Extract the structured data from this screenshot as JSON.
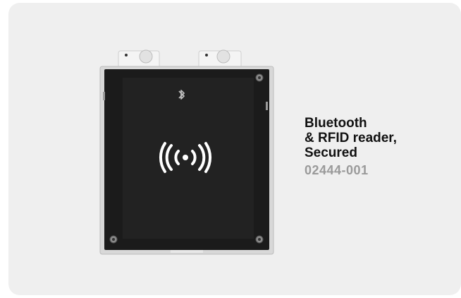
{
  "product": {
    "title": "Bluetooth\n& RFID reader,\nSecured",
    "code": "02444-001"
  },
  "device": {
    "icons": [
      "bluetooth-icon",
      "rfid-icon"
    ],
    "body_color": "#1b1b1b",
    "frame_color": "#d8d8d8"
  }
}
